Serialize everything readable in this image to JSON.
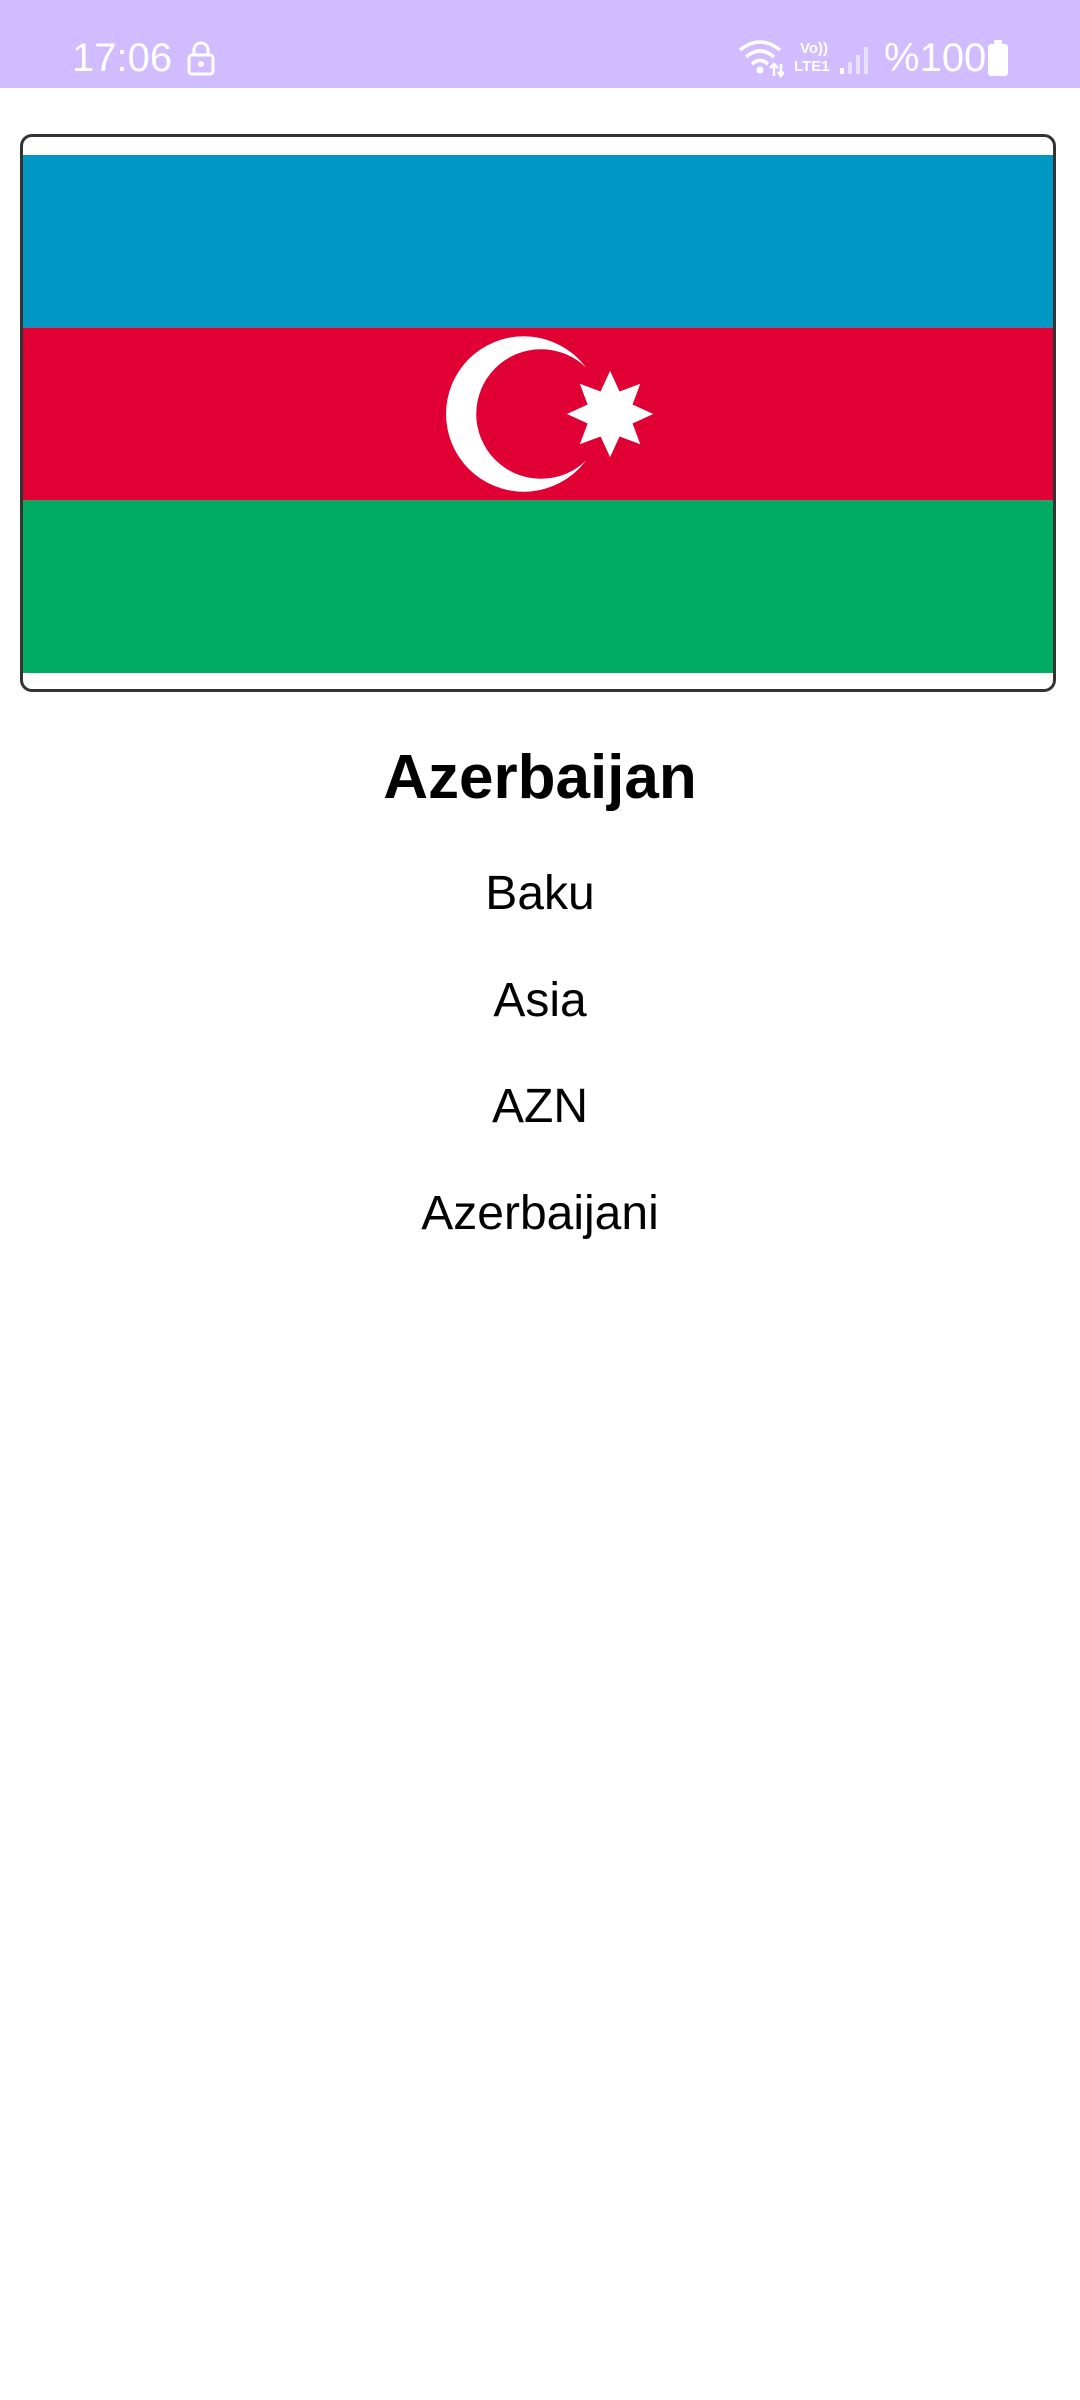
{
  "status_bar": {
    "time": "17:06",
    "battery": "%100",
    "network_label_top": "Vo))",
    "network_label_bottom": "LTE1",
    "icons": [
      "lock-icon",
      "wifi-icon",
      "volte-icon",
      "signal-icon",
      "battery-icon"
    ],
    "background_color": "#d0bcff"
  },
  "flag": {
    "country": "Azerbaijan",
    "colors": {
      "top": "#0097c4",
      "middle": "#e00034",
      "bottom": "#00ac62",
      "emblem": "#ffffff"
    }
  },
  "country": {
    "name": "Azerbaijan",
    "capital": "Baku",
    "region": "Asia",
    "currency": "AZN",
    "demonym": "Azerbaijani"
  }
}
